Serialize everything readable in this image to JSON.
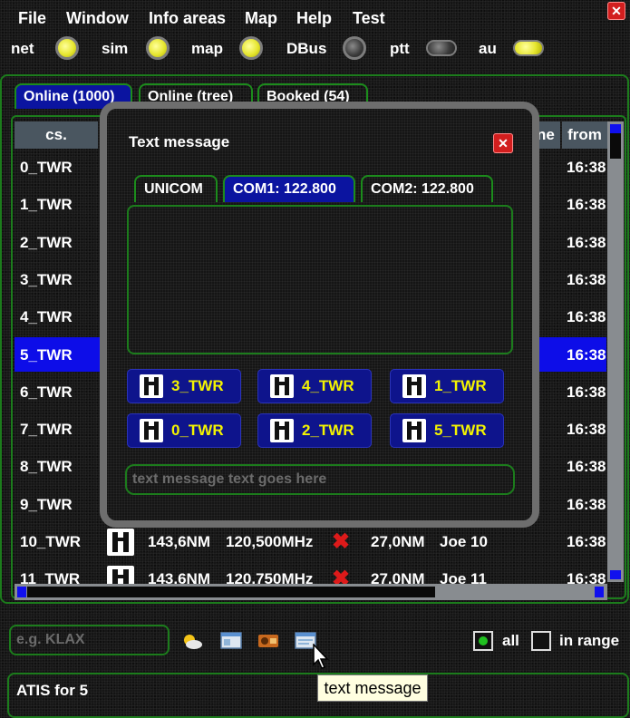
{
  "menu": {
    "file": "File",
    "window": "Window",
    "info_areas": "Info areas",
    "map": "Map",
    "help": "Help",
    "test": "Test"
  },
  "status": {
    "net": "net",
    "sim": "sim",
    "map": "map",
    "dbus": "DBus",
    "ptt": "ptt",
    "au": "au"
  },
  "tabs": {
    "online": "Online (1000)",
    "online_tree": "Online (tree)",
    "booked": "Booked (54)"
  },
  "table": {
    "headers": {
      "cs": "cs.",
      "ne": "ne",
      "from": "from"
    },
    "rows": [
      {
        "cs": "0_TWR",
        "from": "16:38"
      },
      {
        "cs": "1_TWR",
        "from": "16:38"
      },
      {
        "cs": "2_TWR",
        "from": "16:38"
      },
      {
        "cs": "3_TWR",
        "from": "16:38"
      },
      {
        "cs": "4_TWR",
        "from": "16:38"
      },
      {
        "cs": "5_TWR",
        "from": "16:38",
        "selected": true
      },
      {
        "cs": "6_TWR",
        "from": "16:38"
      },
      {
        "cs": "7_TWR",
        "from": "16:38"
      },
      {
        "cs": "8_TWR",
        "from": "16:38"
      },
      {
        "cs": "9_TWR",
        "from": "16:38"
      },
      {
        "cs": "10_TWR",
        "dist": "143,6NM",
        "freq": "120,500MHz",
        "range": "27,0NM",
        "name": "Joe 10",
        "from": "16:38"
      },
      {
        "cs": "11_TWR",
        "dist": "143,6NM",
        "freq": "120,750MHz",
        "range": "27,0NM",
        "name": "Joe 11",
        "from": "16:38"
      }
    ]
  },
  "text_message": {
    "title": "Text message",
    "tabs": {
      "unicom": "UNICOM",
      "com1": "COM1: 122.800",
      "com2": "COM2: 122.800"
    },
    "stations": [
      "3_TWR",
      "4_TWR",
      "1_TWR",
      "0_TWR",
      "2_TWR",
      "5_TWR"
    ],
    "input_placeholder": "text message text goes here"
  },
  "filter": {
    "placeholder": "e.g. KLAX"
  },
  "options": {
    "all": "all",
    "in_range": "in range"
  },
  "atis": {
    "label": "ATIS for 5"
  },
  "tooltip": {
    "text": "text message"
  },
  "colors": {
    "accent": "#0b14a0",
    "border": "#1c7c1c",
    "highlight": "#0d0de8",
    "station_text": "#f4f400",
    "close": "#d21e1e"
  },
  "icons": {
    "app_close": "close-icon",
    "tower": "tower-icon",
    "weather": "weather-icon",
    "cross": "cross-icon"
  }
}
